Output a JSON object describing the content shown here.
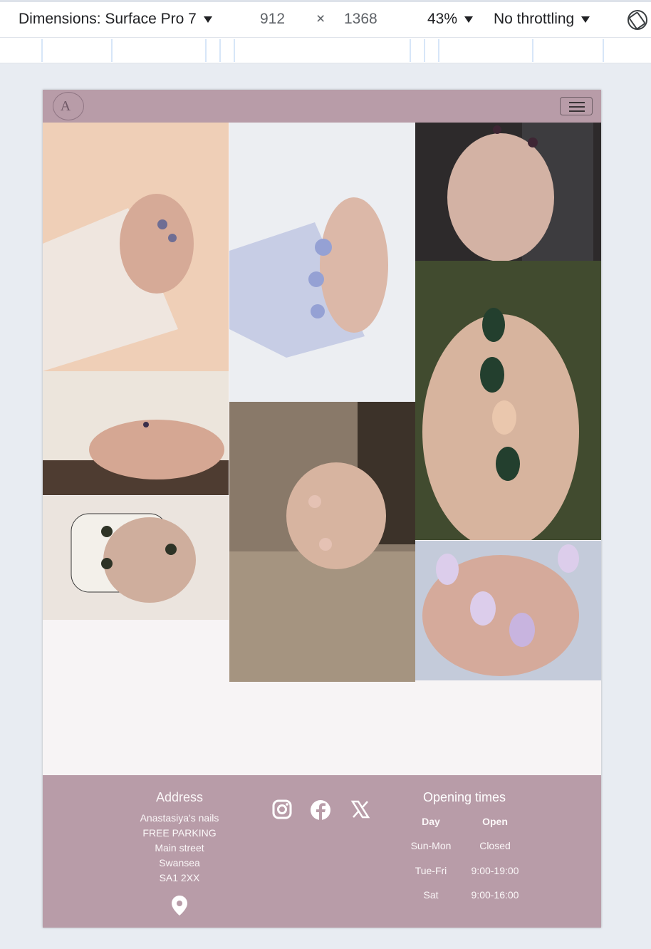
{
  "devtools": {
    "dimensions_label": "Dimensions: Surface Pro 7",
    "width": "912",
    "times": "×",
    "height": "1368",
    "zoom": "43%",
    "throttling": "No throttling"
  },
  "site": {
    "logo_text": "A",
    "gallery": [
      {
        "name": "pink-manicure-linen",
        "colors": [
          "#eecdb5",
          "#f6dcc6",
          "#d6b3a5"
        ]
      },
      {
        "name": "lavender-nails-sweater",
        "colors": [
          "#eef0f3",
          "#c9cfe4",
          "#f2f3f6"
        ]
      },
      {
        "name": "dark-nails-phone",
        "colors": [
          "#2c2a2c",
          "#d2b5a6",
          "#4a3a43"
        ]
      },
      {
        "name": "nude-hands-ring",
        "colors": [
          "#efe8df",
          "#d4a895",
          "#5d4a3f"
        ]
      },
      {
        "name": "green-nails-leaf",
        "colors": [
          "#3f4a2b",
          "#d7b49b",
          "#24412f"
        ]
      },
      {
        "name": "dotted-nails-knit",
        "colors": [
          "#8b7b6b",
          "#b9a78f",
          "#3e342a"
        ]
      },
      {
        "name": "dark-nails-mug",
        "colors": [
          "#ece5df",
          "#cfae9d",
          "#2f3326"
        ]
      },
      {
        "name": "marble-nails",
        "colors": [
          "#c4cbdb",
          "#e7d9ef",
          "#b5a3d2"
        ]
      }
    ]
  },
  "footer": {
    "address_title": "Address",
    "address_lines": [
      "Anastasiya's nails",
      "FREE PARKING",
      "Main street",
      "Swansea",
      "SA1 2XX"
    ],
    "hours_title": "Opening times",
    "hours_headers": [
      "Day",
      "Open"
    ],
    "hours_rows": [
      [
        "Sun-Mon",
        "Closed"
      ],
      [
        "Tue-Fri",
        "9:00-19:00"
      ],
      [
        "Sat",
        "9:00-16:00"
      ]
    ]
  }
}
